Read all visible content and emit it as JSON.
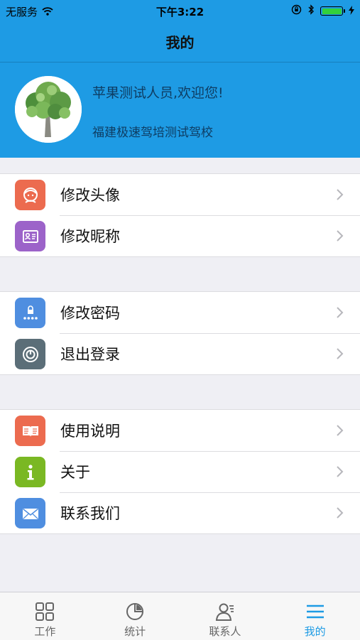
{
  "status_bar": {
    "carrier": "无服务",
    "time": "下午3:22",
    "battery_color": "#33d13a"
  },
  "nav": {
    "title": "我的"
  },
  "profile": {
    "welcome": "苹果测试人员,欢迎您!",
    "school": "福建极速驾培测试驾校"
  },
  "menu": {
    "group1": [
      {
        "label": "修改头像",
        "icon": "avatar-edit-icon",
        "color": "#ec6b4f"
      },
      {
        "label": "修改昵称",
        "icon": "nickname-card-icon",
        "color": "#9c63c9"
      }
    ],
    "group2": [
      {
        "label": "修改密码",
        "icon": "password-lock-icon",
        "color": "#4f8ee0"
      },
      {
        "label": "退出登录",
        "icon": "power-icon",
        "color": "#5b6e78"
      }
    ],
    "group3": [
      {
        "label": "使用说明",
        "icon": "book-icon",
        "color": "#ec6b4f"
      },
      {
        "label": "关于",
        "icon": "info-icon",
        "color": "#7ab823"
      },
      {
        "label": "联系我们",
        "icon": "mail-icon",
        "color": "#4f8ee0"
      }
    ]
  },
  "tabbar": {
    "tabs": [
      {
        "label": "工作",
        "icon": "grid-icon"
      },
      {
        "label": "统计",
        "icon": "pie-chart-icon"
      },
      {
        "label": "联系人",
        "icon": "contacts-icon"
      },
      {
        "label": "我的",
        "icon": "menu-lines-icon"
      }
    ],
    "active_index": 3,
    "active_color": "#1e9be4"
  },
  "colors": {
    "primary": "#1e9be4",
    "background": "#efeff4"
  }
}
